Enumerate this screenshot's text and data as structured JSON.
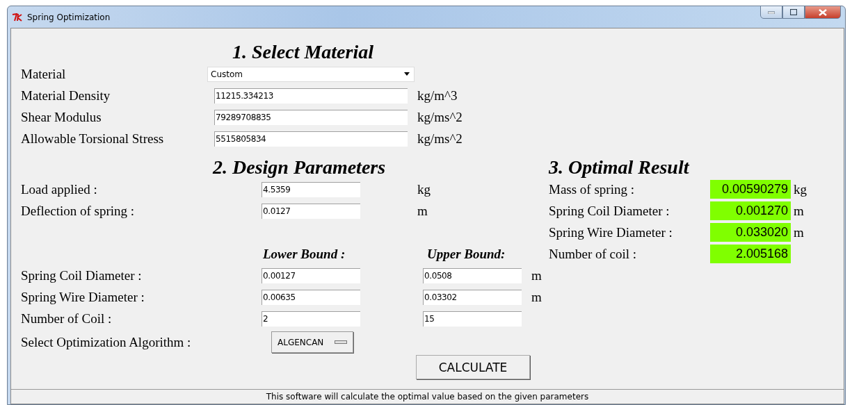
{
  "window": {
    "title": "Spring Optimization"
  },
  "material_section": {
    "heading": "1. Select Material",
    "material": {
      "label": "Material",
      "value": "Custom"
    },
    "properties": [
      {
        "label": "Material Density",
        "value": "11215.334213",
        "unit": "kg/m^3"
      },
      {
        "label": "Shear Modulus",
        "value": "79289708835",
        "unit": "kg/ms^2"
      },
      {
        "label": "Allowable Torsional Stress",
        "value": "5515805834",
        "unit": "kg/ms^2"
      }
    ]
  },
  "design_section": {
    "heading": "2. Design Parameters",
    "parameters": [
      {
        "label": "Load applied :",
        "value": "4.5359",
        "unit": "kg"
      },
      {
        "label": "Deflection of spring :",
        "value": "0.0127",
        "unit": "m"
      }
    ],
    "lower_bound_heading": "Lower Bound :",
    "upper_bound_heading": "Upper Bound:",
    "bounds": [
      {
        "label": "Spring Coil Diameter :",
        "lower": "0.00127",
        "upper": "0.0508",
        "unit": "m"
      },
      {
        "label": "Spring Wire Diameter :",
        "lower": "0.00635",
        "upper": "0.03302",
        "unit": "m"
      },
      {
        "label": "Number of Coil :",
        "lower": "2",
        "upper": "15"
      }
    ],
    "algorithm": {
      "label": "Select Optimization Algorithm :",
      "value": "ALGENCAN"
    },
    "calculate_button": "CALCULATE"
  },
  "result_section": {
    "heading": "3. Optimal Result",
    "results": [
      {
        "label": "Mass of spring :",
        "value": "0.00590279",
        "unit": "kg"
      },
      {
        "label": "Spring Coil Diameter :",
        "value": "0.001270",
        "unit": "m"
      },
      {
        "label": "Spring Wire Diameter :",
        "value": "0.033020",
        "unit": "m"
      },
      {
        "label": "Number of coil :",
        "value": "2.005168"
      }
    ]
  },
  "status_bar": "This software will calculate the optimal value based on the given parameters"
}
